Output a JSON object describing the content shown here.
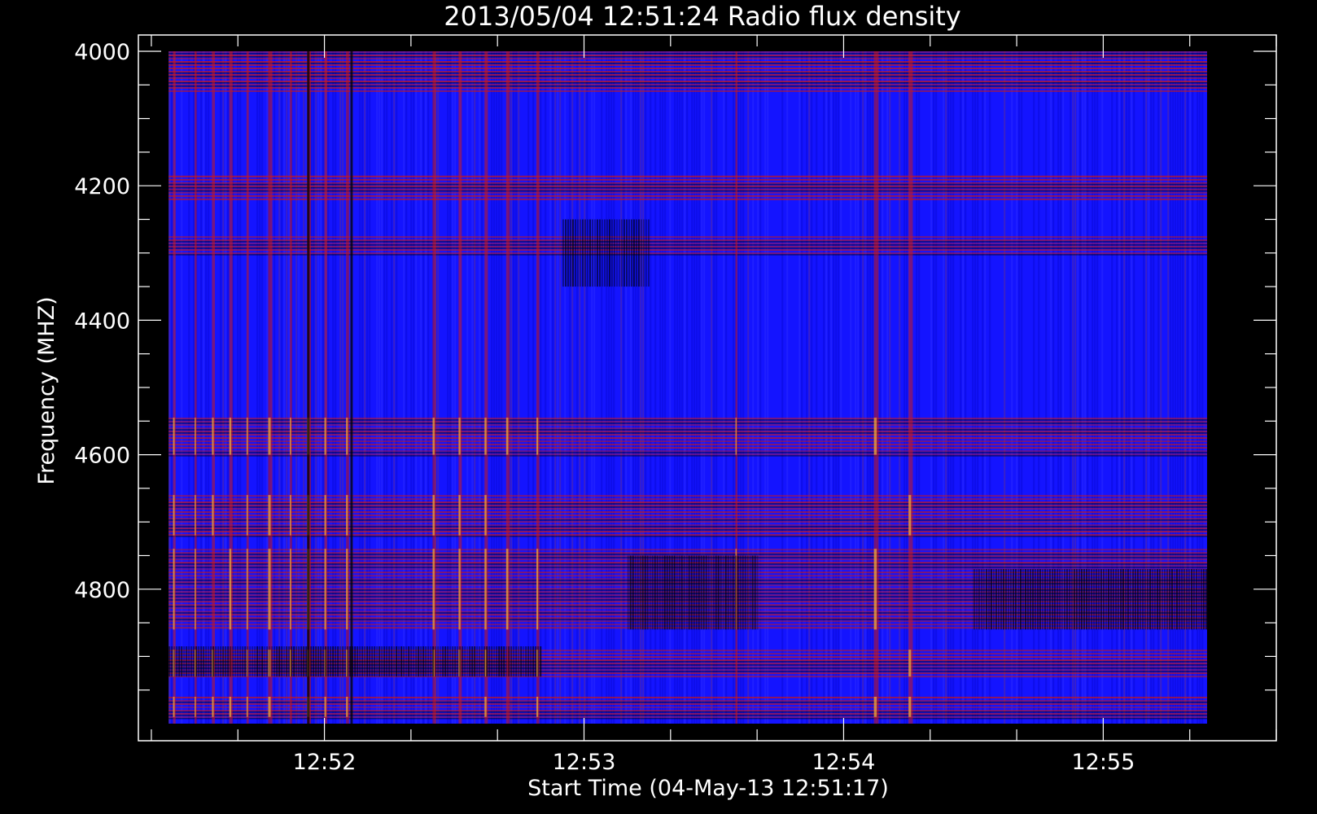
{
  "chart_data": {
    "type": "heatmap",
    "title": "2013/05/04 12:51:24 Radio flux density",
    "xlabel": "Start Time (04-May-13 12:51:17)",
    "ylabel": "Frequency (MHZ)",
    "xlim": [
      "12:51:17",
      "12:55:40"
    ],
    "ylim": [
      4000,
      5000
    ],
    "data_extent": {
      "x": [
        "12:51:24",
        "12:55:24"
      ],
      "y": [
        4000,
        5000
      ]
    },
    "x_ticks": [
      "12:52",
      "12:53",
      "12:54",
      "12:55"
    ],
    "x_minor_step_seconds": 20,
    "y_ticks": [
      4000,
      4200,
      4400,
      4600,
      4800
    ],
    "y_minor_step": 50,
    "y_reversed": true,
    "grid": false,
    "colormap": [
      "#000000",
      "#1010ff",
      "#c81818",
      "#ffe040"
    ],
    "background_color": "#1414ff",
    "axis_color": "#ffffff",
    "bright_frequency_bands_mhz": [
      [
        4000,
        4060
      ],
      [
        4185,
        4220
      ],
      [
        4275,
        4300
      ],
      [
        4545,
        4600
      ],
      [
        4660,
        4720
      ],
      [
        4740,
        4860
      ],
      [
        4890,
        4930
      ],
      [
        4960,
        4990
      ]
    ],
    "bright_time_columns": [
      "12:51:25",
      "12:51:30",
      "12:51:34",
      "12:51:38",
      "12:51:42",
      "12:51:47",
      "12:51:52",
      "12:51:56",
      "12:52:00",
      "12:52:05",
      "12:52:25",
      "12:52:31",
      "12:52:37",
      "12:52:42",
      "12:52:49",
      "12:53:35",
      "12:54:07",
      "12:54:15"
    ],
    "dark_time_columns": [
      "12:51:56",
      "12:52:06"
    ],
    "dark_features": [
      {
        "x": [
          "12:52:55",
          "12:53:15"
        ],
        "y": [
          4250,
          4350
        ]
      },
      {
        "x": [
          "12:53:10",
          "12:53:40"
        ],
        "y": [
          4750,
          4860
        ]
      },
      {
        "x": [
          "12:54:30",
          "12:55:24"
        ],
        "y": [
          4770,
          4860
        ]
      },
      {
        "x": [
          "12:51:24",
          "12:52:50"
        ],
        "y": [
          4885,
          4930
        ]
      }
    ]
  }
}
